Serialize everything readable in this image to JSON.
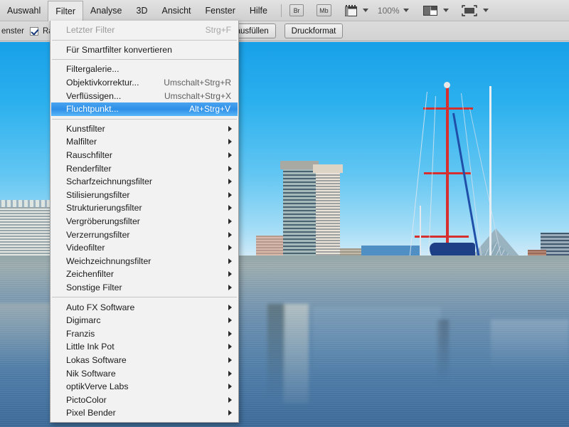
{
  "menubar": {
    "items": [
      {
        "label": "Auswahl",
        "active": false
      },
      {
        "label": "Filter",
        "active": true
      },
      {
        "label": "Analyse",
        "active": false
      },
      {
        "label": "3D",
        "active": false
      },
      {
        "label": "Ansicht",
        "active": false
      },
      {
        "label": "Fenster",
        "active": false
      },
      {
        "label": "Hilfe",
        "active": false
      }
    ],
    "bridge_label": "Br",
    "minibridge_label": "Mb",
    "zoom_level": "100%",
    "icons": {
      "bridge": "bridge-icon",
      "mini_bridge": "mini-bridge-icon",
      "extras": "view-extras-icon",
      "screen_mode": "screen-mode-icon",
      "arrange": "arrange-documents-icon"
    }
  },
  "optionsbar": {
    "left_text": "enster",
    "checkbox_label": "Raue",
    "checkbox_checked": true,
    "fill_screen_button": "irm ausfüllen",
    "print_format_button": "Druckformat"
  },
  "filter_menu": {
    "groups": [
      {
        "items": [
          {
            "label": "Letzter Filter",
            "shortcut": "Strg+F",
            "disabled": true,
            "submenu": false,
            "selected": false
          }
        ]
      },
      {
        "items": [
          {
            "label": "Für Smartfilter konvertieren",
            "shortcut": "",
            "disabled": false,
            "submenu": false,
            "selected": false
          }
        ]
      },
      {
        "items": [
          {
            "label": "Filtergalerie...",
            "shortcut": "",
            "disabled": false,
            "submenu": false,
            "selected": false
          },
          {
            "label": "Objektivkorrektur...",
            "shortcut": "Umschalt+Strg+R",
            "disabled": false,
            "submenu": false,
            "selected": false
          },
          {
            "label": "Verflüssigen...",
            "shortcut": "Umschalt+Strg+X",
            "disabled": false,
            "submenu": false,
            "selected": false
          },
          {
            "label": "Fluchtpunkt...",
            "shortcut": "Alt+Strg+V",
            "disabled": false,
            "submenu": false,
            "selected": true
          }
        ]
      },
      {
        "items": [
          {
            "label": "Kunstfilter",
            "shortcut": "",
            "disabled": false,
            "submenu": true,
            "selected": false
          },
          {
            "label": "Malfilter",
            "shortcut": "",
            "disabled": false,
            "submenu": true,
            "selected": false
          },
          {
            "label": "Rauschfilter",
            "shortcut": "",
            "disabled": false,
            "submenu": true,
            "selected": false
          },
          {
            "label": "Renderfilter",
            "shortcut": "",
            "disabled": false,
            "submenu": true,
            "selected": false
          },
          {
            "label": "Scharfzeichnungsfilter",
            "shortcut": "",
            "disabled": false,
            "submenu": true,
            "selected": false
          },
          {
            "label": "Stilisierungsfilter",
            "shortcut": "",
            "disabled": false,
            "submenu": true,
            "selected": false
          },
          {
            "label": "Strukturierungsfilter",
            "shortcut": "",
            "disabled": false,
            "submenu": true,
            "selected": false
          },
          {
            "label": "Vergröberungsfilter",
            "shortcut": "",
            "disabled": false,
            "submenu": true,
            "selected": false
          },
          {
            "label": "Verzerrungsfilter",
            "shortcut": "",
            "disabled": false,
            "submenu": true,
            "selected": false
          },
          {
            "label": "Videofilter",
            "shortcut": "",
            "disabled": false,
            "submenu": true,
            "selected": false
          },
          {
            "label": "Weichzeichnungsfilter",
            "shortcut": "",
            "disabled": false,
            "submenu": true,
            "selected": false
          },
          {
            "label": "Zeichenfilter",
            "shortcut": "",
            "disabled": false,
            "submenu": true,
            "selected": false
          },
          {
            "label": "Sonstige Filter",
            "shortcut": "",
            "disabled": false,
            "submenu": true,
            "selected": false
          }
        ]
      },
      {
        "items": [
          {
            "label": "Auto FX Software",
            "shortcut": "",
            "disabled": false,
            "submenu": true,
            "selected": false
          },
          {
            "label": "Digimarc",
            "shortcut": "",
            "disabled": false,
            "submenu": true,
            "selected": false
          },
          {
            "label": "Franzis",
            "shortcut": "",
            "disabled": false,
            "submenu": true,
            "selected": false
          },
          {
            "label": "Little Ink Pot",
            "shortcut": "",
            "disabled": false,
            "submenu": true,
            "selected": false
          },
          {
            "label": "Lokas Software",
            "shortcut": "",
            "disabled": false,
            "submenu": true,
            "selected": false
          },
          {
            "label": "Nik Software",
            "shortcut": "",
            "disabled": false,
            "submenu": true,
            "selected": false
          },
          {
            "label": "optikVerve Labs",
            "shortcut": "",
            "disabled": false,
            "submenu": true,
            "selected": false
          },
          {
            "label": "PictoColor",
            "shortcut": "",
            "disabled": false,
            "submenu": true,
            "selected": false
          },
          {
            "label": "Pixel Bender",
            "shortcut": "",
            "disabled": false,
            "submenu": true,
            "selected": false
          }
        ]
      }
    ]
  },
  "document": {
    "description": "Baltimore Inner Harbor photograph with sailboat and skyline"
  },
  "colors": {
    "menu_highlight": "#2f90e8",
    "menubar_bg": "#d9d9d9",
    "dropdown_bg": "#f2f2f2",
    "sky": "#2bb0ee",
    "water": "#5c87ae",
    "mast_red": "#d62f2f",
    "mast_blue": "#1f4fa8"
  }
}
